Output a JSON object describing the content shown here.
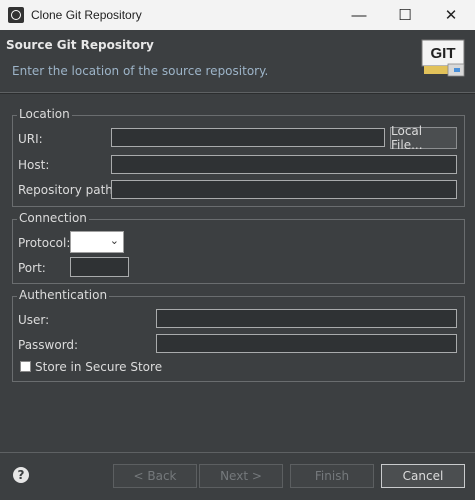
{
  "window": {
    "title": "Clone Git Repository",
    "minimize_glyph": "—",
    "maximize_glyph": "☐",
    "close_glyph": "✕"
  },
  "header": {
    "heading": "Source Git Repository",
    "description": "Enter the location of the source repository.",
    "logo_text": "GIT"
  },
  "location": {
    "group_label": "Location",
    "uri_label": "URI:",
    "uri_value": "",
    "local_file_button": "Local File...",
    "host_label": "Host:",
    "host_value": "",
    "repo_path_label": "Repository path:",
    "repo_path_value": ""
  },
  "connection": {
    "group_label": "Connection",
    "protocol_label": "Protocol:",
    "protocol_value": "",
    "port_label": "Port:",
    "port_value": ""
  },
  "authentication": {
    "group_label": "Authentication",
    "user_label": "User:",
    "user_value": "",
    "password_label": "Password:",
    "password_value": "",
    "store_label": "Store in Secure Store",
    "store_checked": false
  },
  "footer": {
    "help_glyph": "?",
    "back_label": "< Back",
    "next_label": "Next >",
    "finish_label": "Finish",
    "cancel_label": "Cancel"
  },
  "colors": {
    "background": "#3c3f41",
    "titlebar": "#f3f3f3",
    "description_text": "#9db4c8"
  }
}
